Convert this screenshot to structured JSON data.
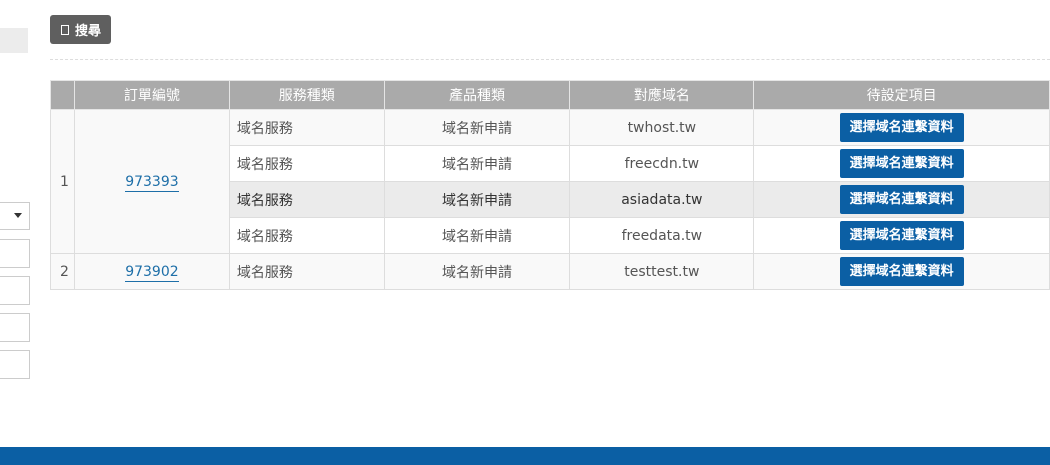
{
  "search": {
    "label": "搜尋",
    "icon": "square-icon"
  },
  "table": {
    "headers": [
      "",
      "訂單編號",
      "服務種類",
      "產品種類",
      "對應域名",
      "待設定項目"
    ],
    "groups": [
      {
        "index": "1",
        "order": "973393",
        "rows": [
          {
            "service": "域名服務",
            "product": "域名新申請",
            "domain": "twhost.tw",
            "action": "選擇域名連繫資料"
          },
          {
            "service": "域名服務",
            "product": "域名新申請",
            "domain": "freecdn.tw",
            "action": "選擇域名連繫資料"
          },
          {
            "service": "域名服務",
            "product": "域名新申請",
            "domain": "asiadata.tw",
            "action": "選擇域名連繫資料"
          },
          {
            "service": "域名服務",
            "product": "域名新申請",
            "domain": "freedata.tw",
            "action": "選擇域名連繫資料"
          }
        ]
      },
      {
        "index": "2",
        "order": "973902",
        "rows": [
          {
            "service": "域名服務",
            "product": "域名新申請",
            "domain": "testtest.tw",
            "action": "選擇域名連繫資料"
          }
        ]
      }
    ]
  },
  "colors": {
    "primary": "#0b5fa4",
    "header": "#aaaaaa",
    "search_btn": "#5f5f5f"
  }
}
